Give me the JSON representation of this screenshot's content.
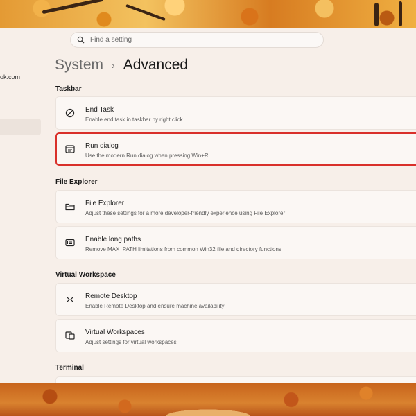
{
  "search": {
    "placeholder": "Find a setting",
    "icon": "search-icon"
  },
  "sidebar": {
    "account_email_fragment": "ok.com"
  },
  "breadcrumb": {
    "parent": "System",
    "separator": "›",
    "current": "Advanced"
  },
  "sections": [
    {
      "title": "Taskbar",
      "items": [
        {
          "title": "End Task",
          "description": "Enable end task in taskbar by right click",
          "icon": "block-icon"
        },
        {
          "title": "Run dialog",
          "description": "Use the modern Run dialog when pressing Win+R",
          "icon": "run-dialog-icon",
          "highlighted": true
        }
      ]
    },
    {
      "title": "File Explorer",
      "items": [
        {
          "title": "File Explorer",
          "description": "Adjust these settings for a more developer-friendly experience using File Explorer",
          "icon": "folder-icon"
        },
        {
          "title": "Enable long paths",
          "description": "Remove MAX_PATH limitations from common Win32 file and directory functions",
          "icon": "long-paths-icon"
        }
      ]
    },
    {
      "title": "Virtual Workspace",
      "items": [
        {
          "title": "Remote Desktop",
          "description": "Enable Remote Desktop and ensure machine availability",
          "icon": "remote-desktop-icon"
        },
        {
          "title": "Virtual Workspaces",
          "description": "Adjust settings for virtual workspaces",
          "icon": "virtual-workspaces-icon"
        }
      ]
    },
    {
      "title": "Terminal",
      "items": []
    }
  ],
  "colors": {
    "highlight_border": "#d9302a",
    "window_bg": "#f7efe9"
  }
}
